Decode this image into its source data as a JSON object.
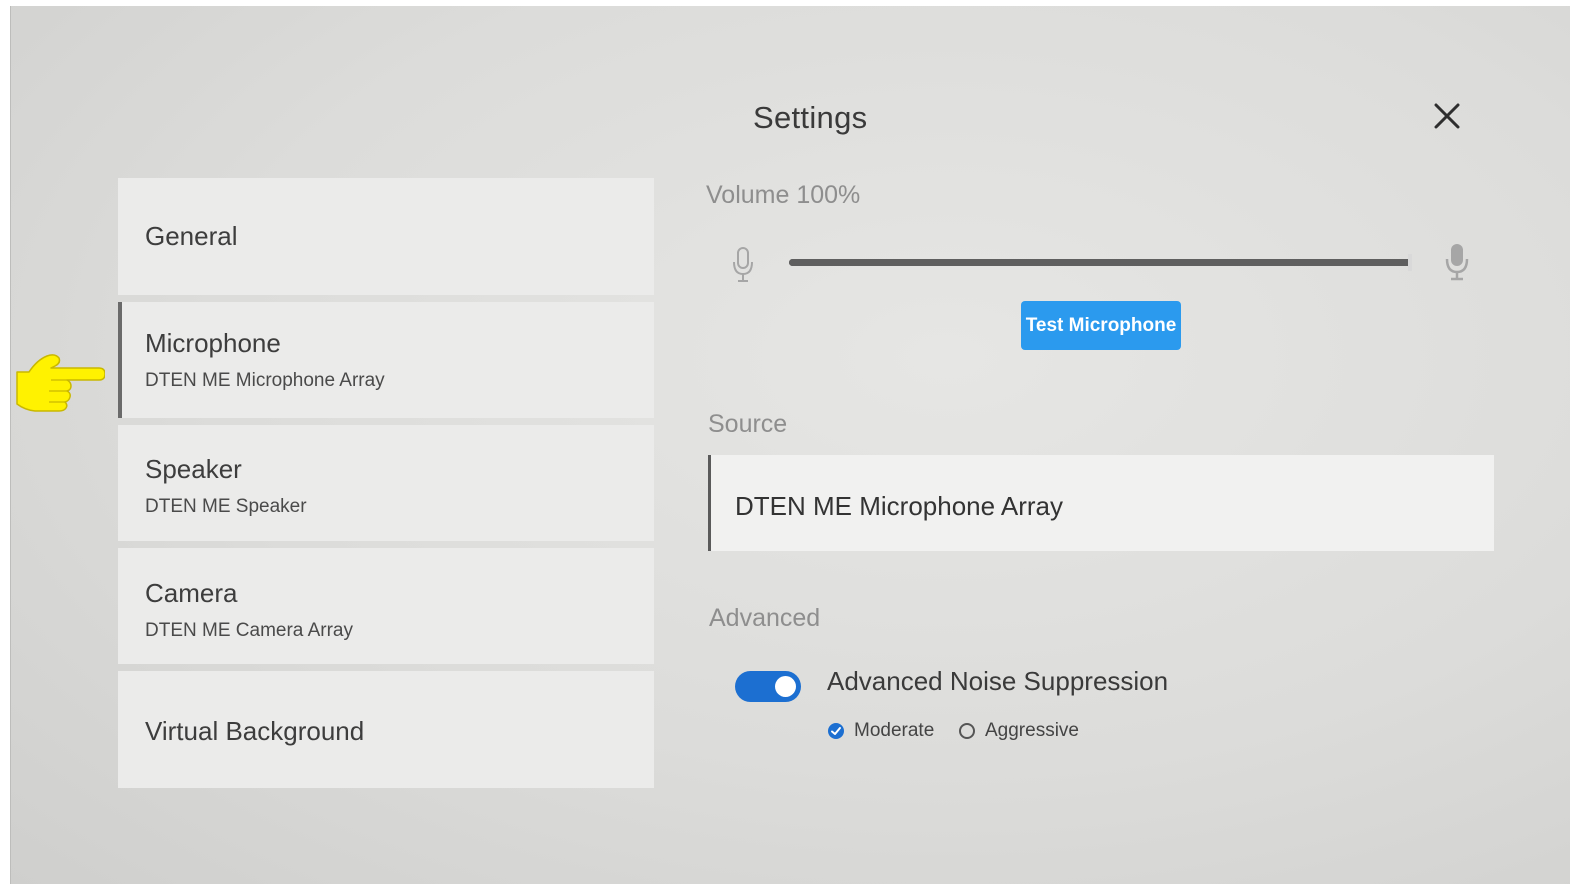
{
  "header": {
    "title": "Settings",
    "close_icon": "close-icon"
  },
  "sidebar": {
    "items": [
      {
        "title": "General",
        "subtitle": ""
      },
      {
        "title": "Microphone",
        "subtitle": "DTEN ME Microphone Array",
        "active": true
      },
      {
        "title": "Speaker",
        "subtitle": "DTEN ME Speaker"
      },
      {
        "title": "Camera",
        "subtitle": "DTEN ME Camera Array"
      },
      {
        "title": "Virtual Background",
        "subtitle": ""
      }
    ]
  },
  "pointer": {
    "icon": "pointing-hand-icon",
    "color": "#FFF200"
  },
  "volume": {
    "label": "Volume 100%",
    "level_fraction": 1.0,
    "low_icon": "microphone-outline-icon",
    "high_icon": "microphone-filled-icon"
  },
  "test_button": {
    "label": "Test Microphone",
    "color": "#2B9AEE"
  },
  "source": {
    "label": "Source",
    "value": "DTEN ME Microphone Array"
  },
  "advanced": {
    "label": "Advanced",
    "noise_suppression": {
      "label": "Advanced Noise Suppression",
      "enabled": true,
      "toggle_color": "#1C6FD1"
    },
    "options": [
      {
        "label": "Moderate",
        "selected": true
      },
      {
        "label": "Aggressive",
        "selected": false
      }
    ]
  }
}
